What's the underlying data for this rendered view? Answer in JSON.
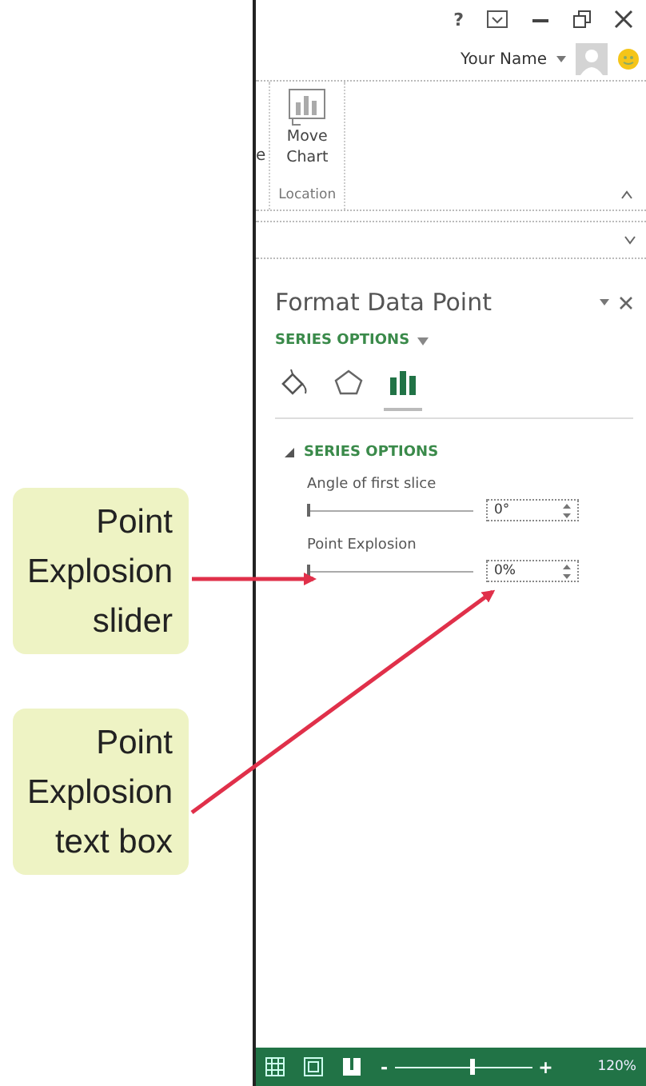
{
  "callouts": [
    {
      "lines": [
        "Point",
        "Explosion",
        "slider"
      ]
    },
    {
      "lines": [
        "Point",
        "Explosion",
        "text box"
      ]
    }
  ],
  "window": {
    "controls": [
      "?"
    ],
    "user": "Your Name"
  },
  "ribbon": {
    "cut_text": "e",
    "group": {
      "button": "Move Chart",
      "label": "Location"
    }
  },
  "pane": {
    "title": "Format Data Point",
    "options_menu": "SERIES OPTIONS",
    "icon_tabs": [
      {
        "kind": "fill",
        "selected": false
      },
      {
        "kind": "effects",
        "selected": false
      },
      {
        "kind": "series",
        "selected": true
      }
    ],
    "section": {
      "title": "SERIES OPTIONS",
      "expanded": true,
      "fields": [
        {
          "label": "Angle of first slice",
          "level": 0,
          "value": "0°"
        },
        {
          "label": "Point Explosion",
          "level": 0,
          "value": "0%"
        }
      ]
    }
  },
  "status_bar": {
    "zoom": {
      "out": "-",
      "in": "+",
      "level": 0.55,
      "reading": "120%"
    }
  }
}
